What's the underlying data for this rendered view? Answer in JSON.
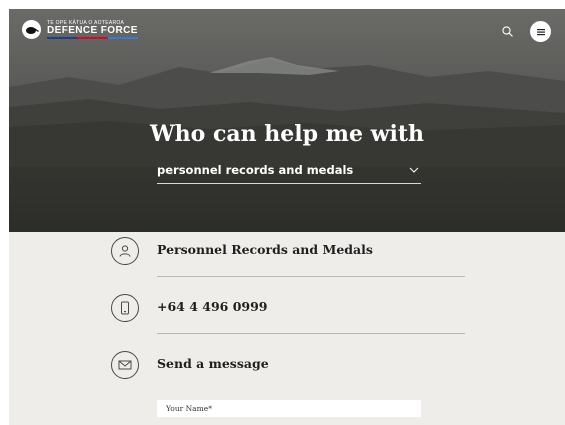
{
  "logo": {
    "small_text": "TE OPE KĀTUA O AOTEAROA",
    "big_text": "DEFENCE FORCE",
    "stripe_colors": [
      "#1d3f8f",
      "#c8102e",
      "#3a7ad1"
    ]
  },
  "header": {
    "search_icon": "search-icon",
    "menu_icon": "menu-icon"
  },
  "hero": {
    "title": "Who can help me with",
    "select_value": "personnel records and medals"
  },
  "contacts": [
    {
      "icon": "person-icon",
      "text": "Personnel Records and Medals"
    },
    {
      "icon": "phone-icon",
      "text": "+64 4 496 0999"
    },
    {
      "icon": "envelope-icon",
      "text": "Send a message"
    }
  ],
  "form": {
    "name_placeholder": "Your Name*"
  },
  "colors": {
    "page_bg": "#eeedea",
    "text_dark": "#1f1f1f",
    "divider": "#b9b9b6"
  }
}
